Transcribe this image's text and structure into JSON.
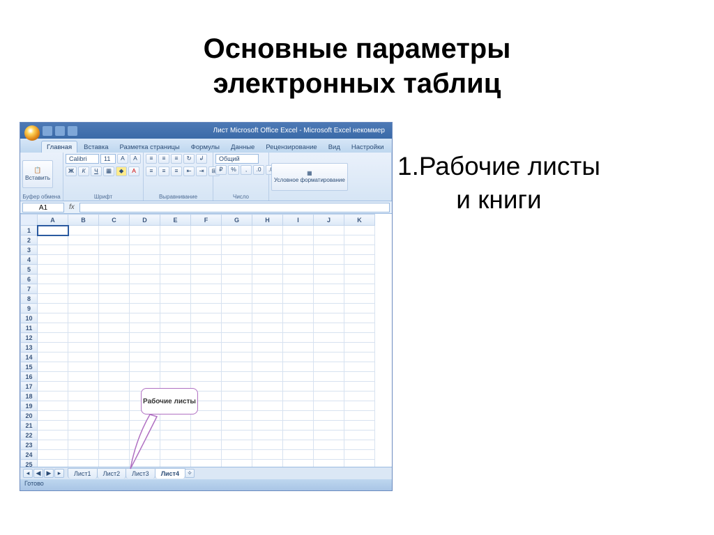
{
  "slide": {
    "title_line1": "Основные параметры",
    "title_line2": "электронных таблиц",
    "body_line1": "1.Рабочие листы",
    "body_line2": "и книги"
  },
  "callout": {
    "text": "Рабочие листы"
  },
  "excel": {
    "titlebar": "Лист Microsoft Office Excel - Microsoft Excel некоммер",
    "tabs": [
      "Главная",
      "Вставка",
      "Разметка страницы",
      "Формулы",
      "Данные",
      "Рецензирование",
      "Вид",
      "Настройки"
    ],
    "groups": {
      "clipboard": {
        "label": "Буфер обмена",
        "paste": "Вставить"
      },
      "font": {
        "label": "Шрифт",
        "family": "Calibri",
        "size": "11"
      },
      "alignment": {
        "label": "Выравнивание"
      },
      "number": {
        "label": "Число",
        "format": "Общий"
      },
      "styles": {
        "label": "",
        "cond_format": "Условное форматирование"
      }
    },
    "namebox": "A1",
    "fx": "fx",
    "columns": [
      "A",
      "B",
      "C",
      "D",
      "E",
      "F",
      "G",
      "H",
      "I",
      "J",
      "K"
    ],
    "row_count": 26,
    "sheet_nav": [
      "◂",
      "◀",
      "▶",
      "▸"
    ],
    "sheets": [
      "Лист1",
      "Лист2",
      "Лист3",
      "Лист4"
    ],
    "active_sheet": "Лист4",
    "status": "Готово"
  }
}
